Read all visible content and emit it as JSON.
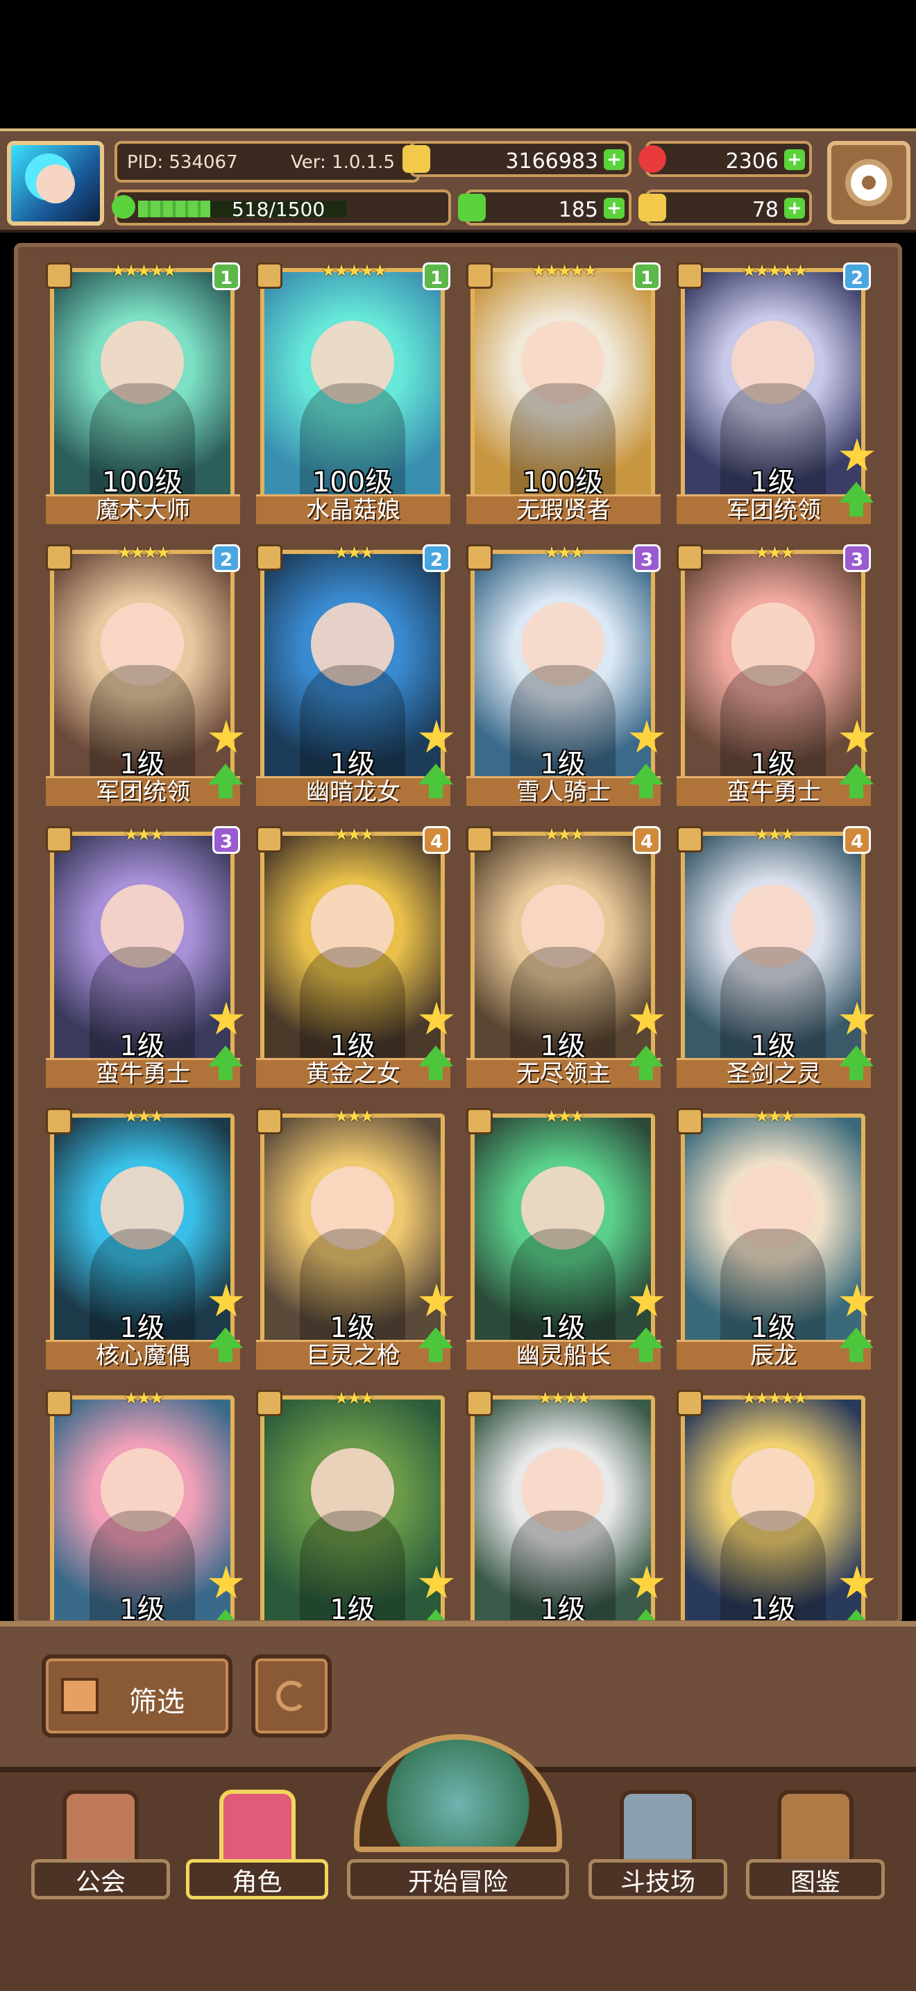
{
  "header": {
    "pid": "PID: 534067",
    "version": "Ver: 1.0.1.5",
    "gold": "3166983",
    "gems": "2306",
    "clover": "185",
    "keys": "78",
    "xp_text": "518/1500",
    "xp_fraction": 0.345
  },
  "cards": [
    {
      "stars": "★★★★★",
      "level": "100级",
      "name": "魔术大师",
      "badge": "1",
      "badge_color": "#5cb84a",
      "bg": "#2c5e5c",
      "tint": "#7de0c4",
      "upgrade": false
    },
    {
      "stars": "★★★★★",
      "level": "100级",
      "name": "水晶菇娘",
      "badge": "1",
      "badge_color": "#5cb84a",
      "bg": "#3a8fb0",
      "tint": "#66e8d8",
      "upgrade": false
    },
    {
      "stars": "★★★★★",
      "level": "100级",
      "name": "无瑕贤者",
      "badge": "1",
      "badge_color": "#5cb84a",
      "bg": "#c89640",
      "tint": "#f0e8d8",
      "upgrade": false
    },
    {
      "stars": "★★★★★",
      "level": "1级",
      "name": "军团统领",
      "badge": "2",
      "badge_color": "#4aa6e0",
      "bg": "#3a3e66",
      "tint": "#c8c8e8",
      "upgrade": true
    },
    {
      "stars": "★★★★",
      "level": "1级",
      "name": "军团统领",
      "badge": "2",
      "badge_color": "#4aa6e0",
      "bg": "#6a4a3a",
      "tint": "#e8c8a0",
      "upgrade": true
    },
    {
      "stars": "★★★",
      "level": "1级",
      "name": "幽暗龙女",
      "badge": "2",
      "badge_color": "#4aa6e0",
      "bg": "#1c3c5a",
      "tint": "#3a8ad0",
      "upgrade": true
    },
    {
      "stars": "★★★",
      "level": "1级",
      "name": "雪人骑士",
      "badge": "3",
      "badge_color": "#9a5ad0",
      "bg": "#3c6a8a",
      "tint": "#dce8f4",
      "upgrade": true
    },
    {
      "stars": "★★★",
      "level": "1级",
      "name": "蛮牛勇士",
      "badge": "3",
      "badge_color": "#9a5ad0",
      "bg": "#6a4a3a",
      "tint": "#f0a8a0",
      "upgrade": true
    },
    {
      "stars": "★★★",
      "level": "1级",
      "name": "蛮牛勇士",
      "badge": "3",
      "badge_color": "#9a5ad0",
      "bg": "#3a3a5c",
      "tint": "#a890d8",
      "upgrade": true
    },
    {
      "stars": "★★★",
      "level": "1级",
      "name": "黄金之女",
      "badge": "4",
      "badge_color": "#d08a3a",
      "bg": "#4a3a2a",
      "tint": "#e8c04a",
      "upgrade": true
    },
    {
      "stars": "★★★",
      "level": "1级",
      "name": "无尽领主",
      "badge": "4",
      "badge_color": "#d08a3a",
      "bg": "#5a4632",
      "tint": "#e8c898",
      "upgrade": true
    },
    {
      "stars": "★★★",
      "level": "1级",
      "name": "圣剑之灵",
      "badge": "4",
      "badge_color": "#d08a3a",
      "bg": "#3a5a6a",
      "tint": "#dce0ec",
      "upgrade": true
    },
    {
      "stars": "★★★",
      "level": "1级",
      "name": "核心魔偶",
      "badge": "",
      "badge_color": "",
      "bg": "#1c3a4a",
      "tint": "#3ac0e8",
      "upgrade": true
    },
    {
      "stars": "★★★",
      "level": "1级",
      "name": "巨灵之枪",
      "badge": "",
      "badge_color": "",
      "bg": "#5a4a3a",
      "tint": "#f0c870",
      "upgrade": true
    },
    {
      "stars": "★★★",
      "level": "1级",
      "name": "幽灵船长",
      "badge": "",
      "badge_color": "",
      "bg": "#2c4a3a",
      "tint": "#5ad08a",
      "upgrade": true
    },
    {
      "stars": "★★★",
      "level": "1级",
      "name": "辰龙",
      "badge": "",
      "badge_color": "",
      "bg": "#3a6a7a",
      "tint": "#f0e0c8",
      "upgrade": true
    },
    {
      "stars": "★★★",
      "level": "1级",
      "name": "",
      "badge": "",
      "badge_color": "",
      "bg": "#3a6a8a",
      "tint": "#f0a0b8",
      "upgrade": true
    },
    {
      "stars": "★★★",
      "level": "1级",
      "name": "",
      "badge": "",
      "badge_color": "",
      "bg": "#2a5a3a",
      "tint": "#6a9a4a",
      "upgrade": true
    },
    {
      "stars": "★★★★",
      "level": "1级",
      "name": "",
      "badge": "",
      "badge_color": "",
      "bg": "#3a5a4a",
      "tint": "#e8e8e8",
      "upgrade": true
    },
    {
      "stars": "★★★★★",
      "level": "1级",
      "name": "",
      "badge": "",
      "badge_color": "",
      "bg": "#2a3a5a",
      "tint": "#f0d070",
      "upgrade": true
    }
  ],
  "toolbar": {
    "filter_label": "筛选"
  },
  "nav": {
    "guild": "公会",
    "characters": "角色",
    "adventure": "开始冒险",
    "arena": "斗技场",
    "codex": "图鉴"
  }
}
